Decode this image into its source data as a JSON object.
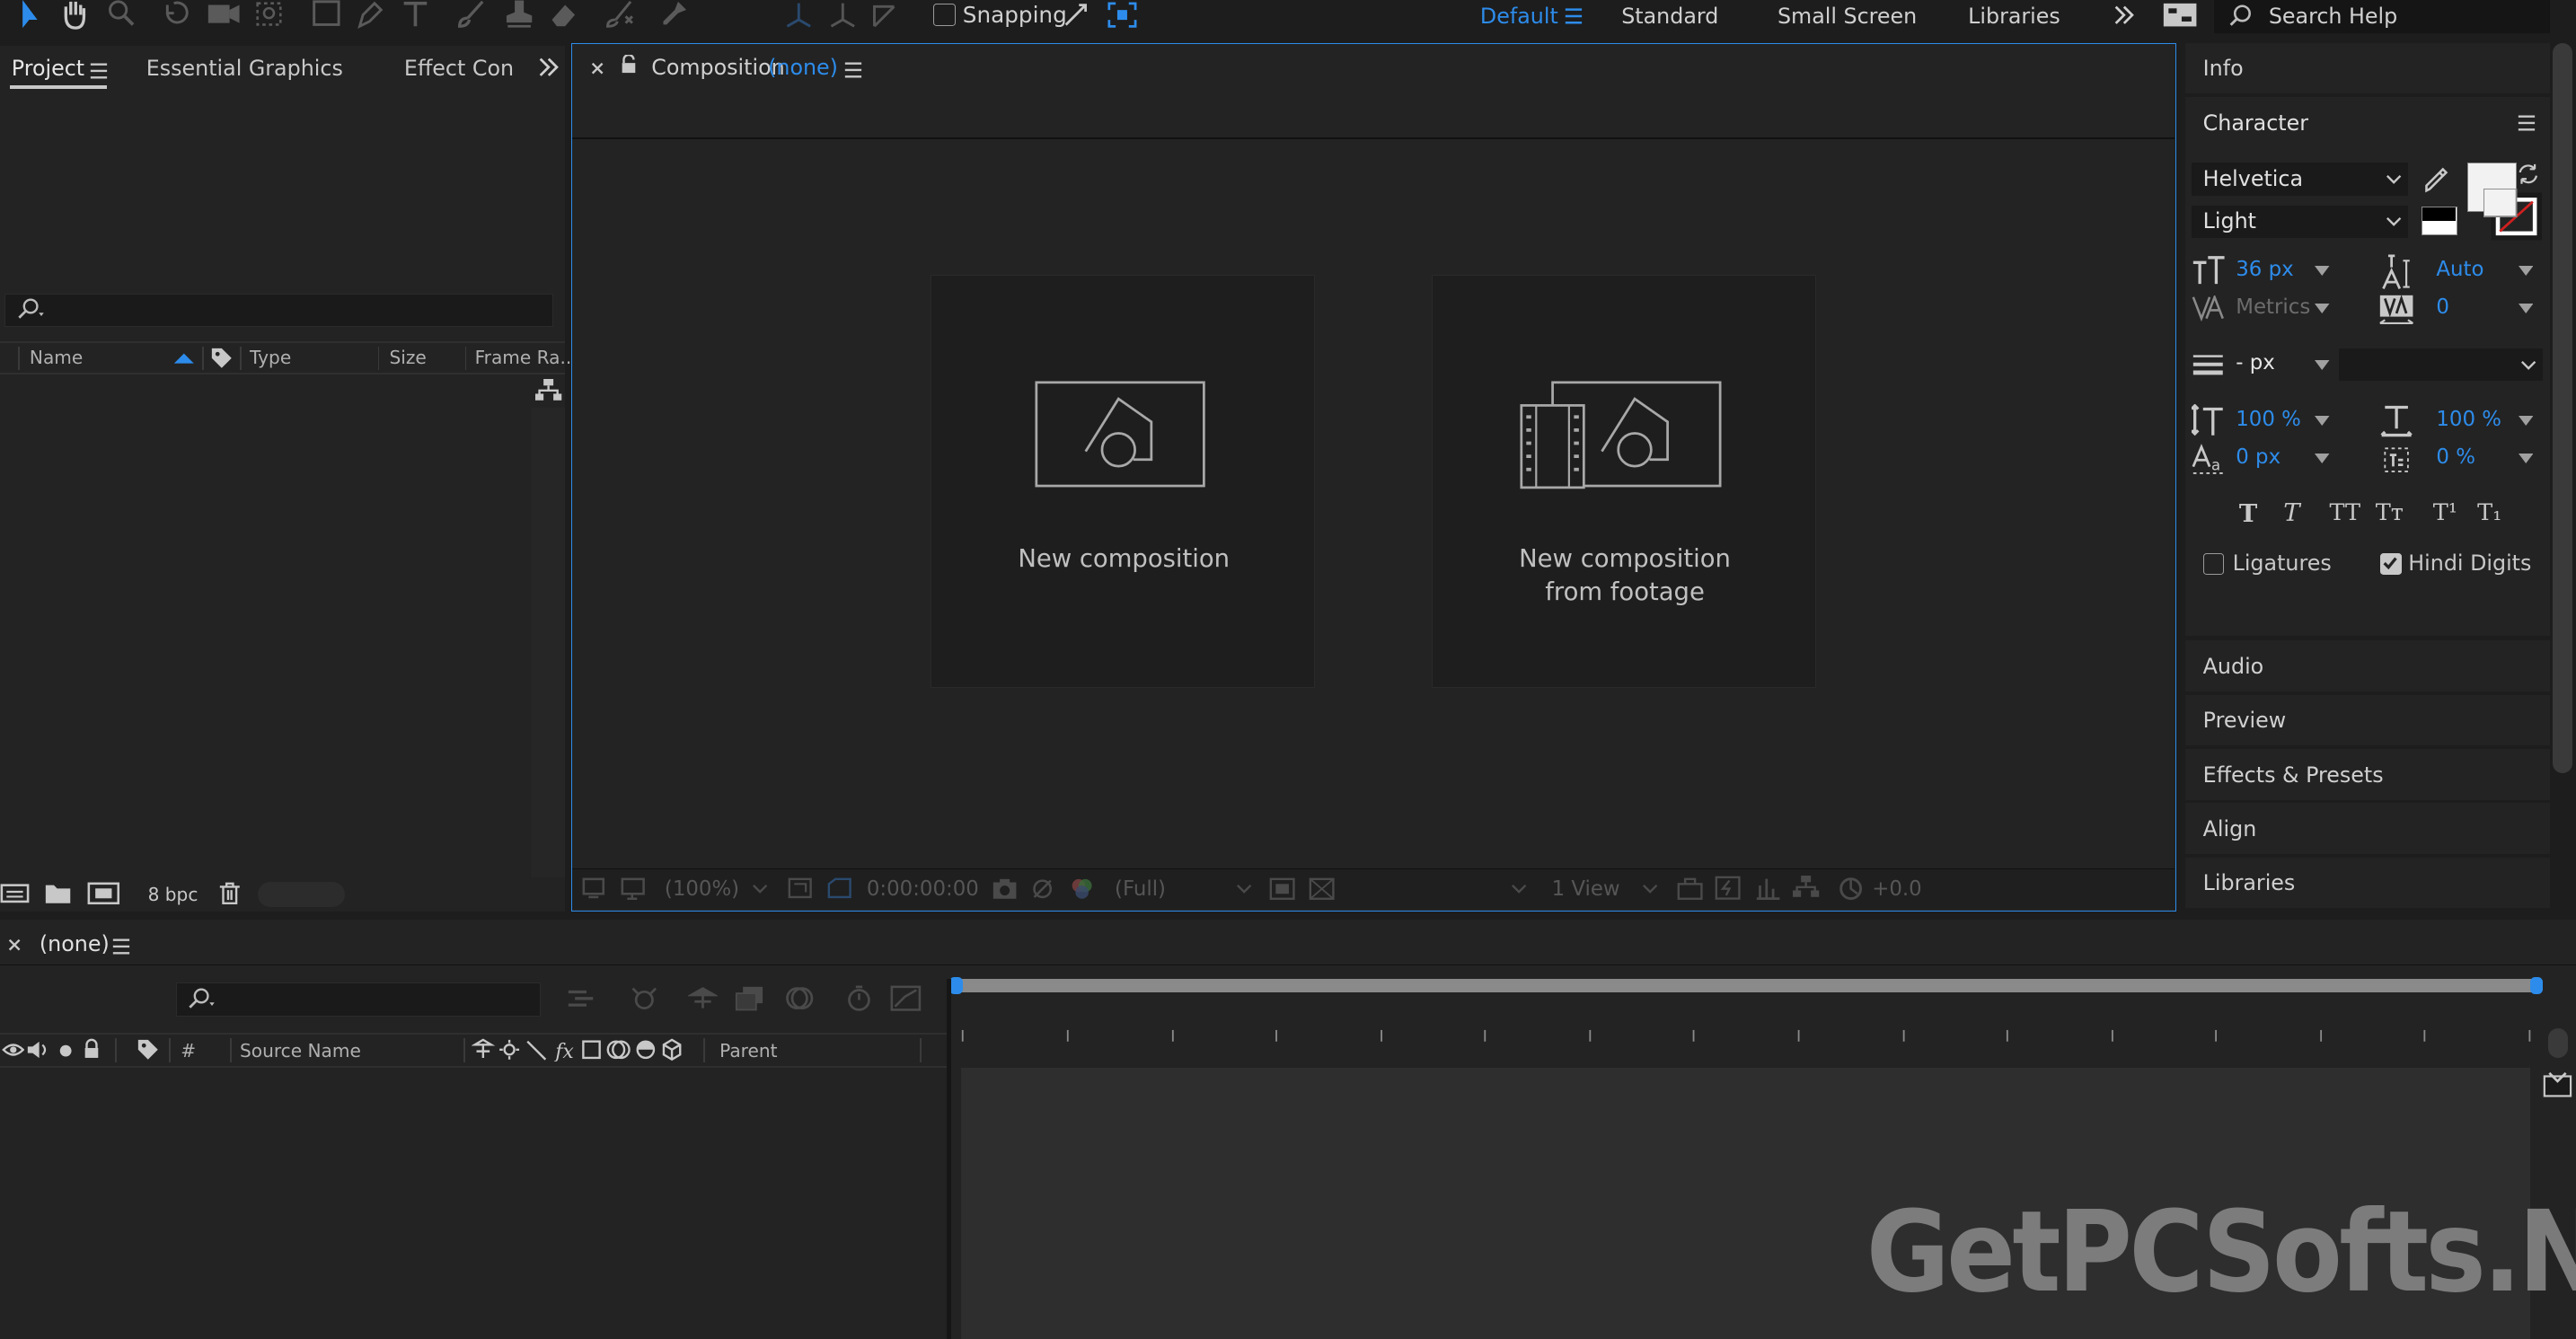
{
  "toolbar": {
    "snapping_label": "Snapping",
    "workspaces": [
      "Default",
      "Standard",
      "Small Screen",
      "Libraries"
    ],
    "search_placeholder": "Search Help"
  },
  "project_panel": {
    "tabs": [
      "Project",
      "Essential Graphics",
      "Effect Con"
    ],
    "columns": [
      "Name",
      "Type",
      "Size",
      "Frame Ra..."
    ],
    "bpc_label": "8 bpc"
  },
  "composition_panel": {
    "title": "Composition",
    "name": "(none)",
    "card1_label": "New composition",
    "card2_line1": "New composition",
    "card2_line2": "from footage",
    "footer": {
      "zoom": "(100%)",
      "timecode": "0:00:00:00",
      "resolution": "(Full)",
      "views": "1 View",
      "exposure": "+0.0"
    }
  },
  "right_panel": {
    "info_label": "Info",
    "character_label": "Character",
    "font_family": "Helvetica",
    "font_style": "Light",
    "font_size": "36 px",
    "leading": "Auto",
    "kerning": "Metrics",
    "tracking": "0",
    "stroke_width": "- px",
    "vertical_scale": "100 %",
    "horizontal_scale": "100 %",
    "baseline_shift": "0 px",
    "tsume": "0 %",
    "style_buttons": [
      "T",
      "T",
      "TT",
      "Tт",
      "T¹",
      "T₁"
    ],
    "ligatures_label": "Ligatures",
    "hindi_digits_label": "Hindi Digits",
    "collapsed_panels": [
      "Audio",
      "Preview",
      "Effects & Presets",
      "Align",
      "Libraries"
    ]
  },
  "timeline": {
    "tab_name": "(none)",
    "columns": [
      "#",
      "Source Name",
      "Parent"
    ]
  },
  "watermark": "GetPCSofts.NET",
  "colors": {
    "accent": "#2d8ceb",
    "background": "#1d1d1d",
    "panel": "#232323"
  }
}
